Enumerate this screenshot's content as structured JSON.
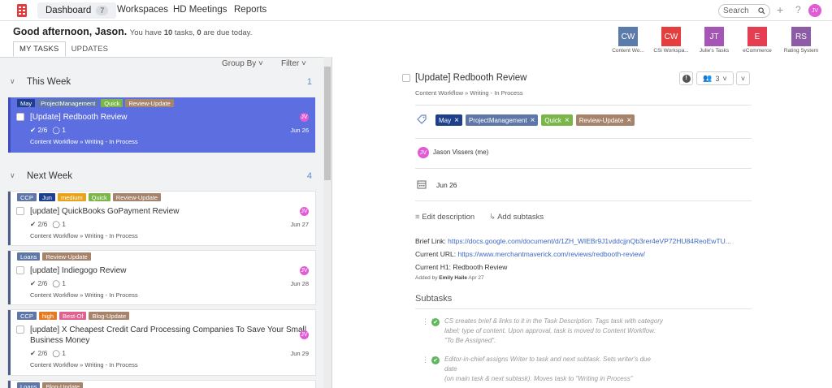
{
  "nav": {
    "dashboard": "Dashboard",
    "dashboard_badge": "7",
    "workspaces": "Workspaces",
    "meetings": "HD Meetings",
    "reports": "Reports",
    "search_placeholder": "Search",
    "user_initials": "JV"
  },
  "greeting": {
    "hello": "Good afternoon, Jason.",
    "pre": "You have",
    "tasks_count": "10",
    "mid": "tasks,",
    "due_count": "0",
    "post": "are due today."
  },
  "tabs": [
    "MY TASKS",
    "UPDATES"
  ],
  "workspaces": [
    {
      "initials": "CW",
      "label": "Content Wo...",
      "color": "#5b7bab"
    },
    {
      "initials": "CW",
      "label": "CSi Workspa...",
      "color": "#e53e3e"
    },
    {
      "initials": "JT",
      "label": "Julie's Tasks",
      "color": "#a455b5"
    },
    {
      "initials": "E",
      "label": "eCommerce",
      "color": "#e53e52"
    },
    {
      "initials": "RS",
      "label": "Rating System",
      "color": "#8e5ba6"
    }
  ],
  "toolbar": {
    "group_by": "Group By",
    "filter": "Filter"
  },
  "sections": [
    {
      "title": "This Week",
      "count": "1"
    },
    {
      "title": "Next Week",
      "count": "4"
    }
  ],
  "tag_colors": {
    "May": "#1d3f8c",
    "ProjectManagement": "#5e77a8",
    "Quick": "#7ab648",
    "Review-Update": "#a5846b",
    "CCP": "#5e77a8",
    "Jun": "#1d3f8c",
    "medium": "#e8a31a",
    "Loans": "#5e77a8",
    "high": "#e67a22",
    "Best-Of": "#e2608e",
    "Blog-Update": "#a5846b"
  },
  "tasks": [
    {
      "tags": [
        "May",
        "ProjectManagement",
        "Quick",
        "Review-Update"
      ],
      "title": "[Update] Redbooth Review",
      "checks": "2/6",
      "comments": "1",
      "path": "Content Workflow » Writing - In Process",
      "due": "Jun 26"
    },
    {
      "tags": [
        "CCP",
        "Jun",
        "medium",
        "Quick",
        "Review-Update"
      ],
      "title": "[update] QuickBooks GoPayment Review",
      "checks": "2/6",
      "comments": "1",
      "path": "Content Workflow » Writing - In Process",
      "due": "Jun 27"
    },
    {
      "tags": [
        "Loans",
        "Review-Update"
      ],
      "title": "[update] Indiegogo Review",
      "checks": "2/6",
      "comments": "1",
      "path": "Content Workflow » Writing - In Process",
      "due": "Jun 28"
    },
    {
      "tags": [
        "CCP",
        "high",
        "Best-Of",
        "Blog-Update"
      ],
      "title": "[update] X Cheapest Credit Card Processing Companies To Save Your Small",
      "title2": "Business Money",
      "checks": "2/6",
      "comments": "1",
      "path": "Content Workflow » Writing - In Process",
      "due": "Jun 29"
    },
    {
      "tags": [
        "Loans",
        "Blog-Update"
      ]
    }
  ],
  "detail": {
    "title": "[Update] Redbooth Review",
    "path": "Content Workflow » Writing - In Process",
    "followers": "3",
    "tags": [
      "May",
      "ProjectManagement",
      "Quick",
      "Review-Update"
    ],
    "assignee": "Jason Vissers (me)",
    "due": "Jun 26",
    "edit_description": "Edit description",
    "add_subtasks": "Add subtasks",
    "brief_label": "Brief Link:",
    "brief_url": "https://docs.google.com/document/d/1ZH_WIEBr9J1vddcjjnQb3rer4eVP72HU84ReoEwTU...",
    "current_url_label": "Current URL:",
    "current_url": "https://www.merchantmaverick.com/reviews/redbooth-review/",
    "current_h1_label": "Current H1:",
    "current_h1": "Redbooth Review",
    "added_by_pre": "Added by",
    "added_by_name": "Emily Haile",
    "added_by_date": "Apr 27",
    "subtasks_heading": "Subtasks",
    "subtasks": [
      {
        "lines": [
          "CS creates brief & links to it in the Task Description. Tags task with category",
          "label; type of content. Upon approval, task is moved to Content Workflow:",
          "\"To Be Assigned\"."
        ]
      },
      {
        "lines": [
          "Editor-in-chief assigns Writer to task and next subtask. Sets writer's due date",
          "(on main task & next subtask). Moves task to \"Writing in Process\""
        ]
      }
    ]
  }
}
